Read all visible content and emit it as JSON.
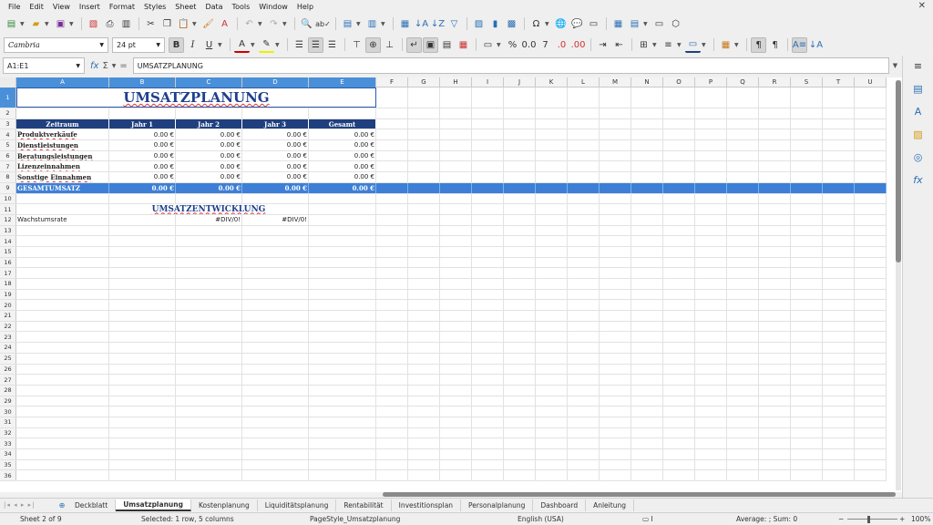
{
  "menu": [
    "File",
    "Edit",
    "View",
    "Insert",
    "Format",
    "Styles",
    "Sheet",
    "Data",
    "Tools",
    "Window",
    "Help"
  ],
  "font": {
    "name": "Cambria",
    "size": "24 pt"
  },
  "formula": {
    "cell_ref": "A1:E1",
    "content": "UMSATZPLANUNG"
  },
  "columns": [
    "A",
    "B",
    "C",
    "D",
    "E",
    "F",
    "G",
    "H",
    "I",
    "J",
    "K",
    "L",
    "M",
    "N",
    "O",
    "P",
    "Q",
    "R",
    "S",
    "T",
    "U"
  ],
  "sheet": {
    "title": "UMSATZPLANUNG",
    "headers": [
      "Zeitraum",
      "Jahr 1",
      "Jahr 2",
      "Jahr 3",
      "Gesamt"
    ],
    "rows": [
      {
        "label": "Produktverkäufe",
        "values": [
          "0.00 €",
          "0.00 €",
          "0.00 €",
          "0.00 €"
        ]
      },
      {
        "label": "Dienstleistungen",
        "values": [
          "0.00 €",
          "0.00 €",
          "0.00 €",
          "0.00 €"
        ]
      },
      {
        "label": "Beratungsleistungen",
        "values": [
          "0.00 €",
          "0.00 €",
          "0.00 €",
          "0.00 €"
        ]
      },
      {
        "label": "Lizenzeinnahmen",
        "values": [
          "0.00 €",
          "0.00 €",
          "0.00 €",
          "0.00 €"
        ]
      },
      {
        "label": "Sonstige Einnahmen",
        "values": [
          "0.00 €",
          "0.00 €",
          "0.00 €",
          "0.00 €"
        ]
      }
    ],
    "total": {
      "label": "GESAMTUMSATZ",
      "values": [
        "0.00 €",
        "0.00 €",
        "0.00 €",
        "0.00 €"
      ]
    },
    "subheading": "UMSATZENTWICKLUNG",
    "growth": {
      "label": "Wachstumsrate",
      "values": [
        "",
        "#DIV/0!",
        "#DIV/0!",
        ""
      ]
    }
  },
  "tabs": [
    "Deckblatt",
    "Umsatzplanung",
    "Kostenplanung",
    "Liquiditätsplanung",
    "Rentabilität",
    "Investitionsplan",
    "Personalplanung",
    "Dashboard",
    "Anleitung"
  ],
  "active_tab": "Umsatzplanung",
  "status": {
    "sheet": "Sheet 2 of 9",
    "selection": "Selected: 1 row, 5 columns",
    "page_style": "PageStyle_Umsatzplanung",
    "language": "English (USA)",
    "aggregate": "Average: ; Sum: 0",
    "zoom": "100%"
  },
  "colors": {
    "header_bg": "#1f3f7f",
    "total_bg": "#3d7fd6",
    "title": "#1f3f8f",
    "selection": "#4a90d9"
  }
}
